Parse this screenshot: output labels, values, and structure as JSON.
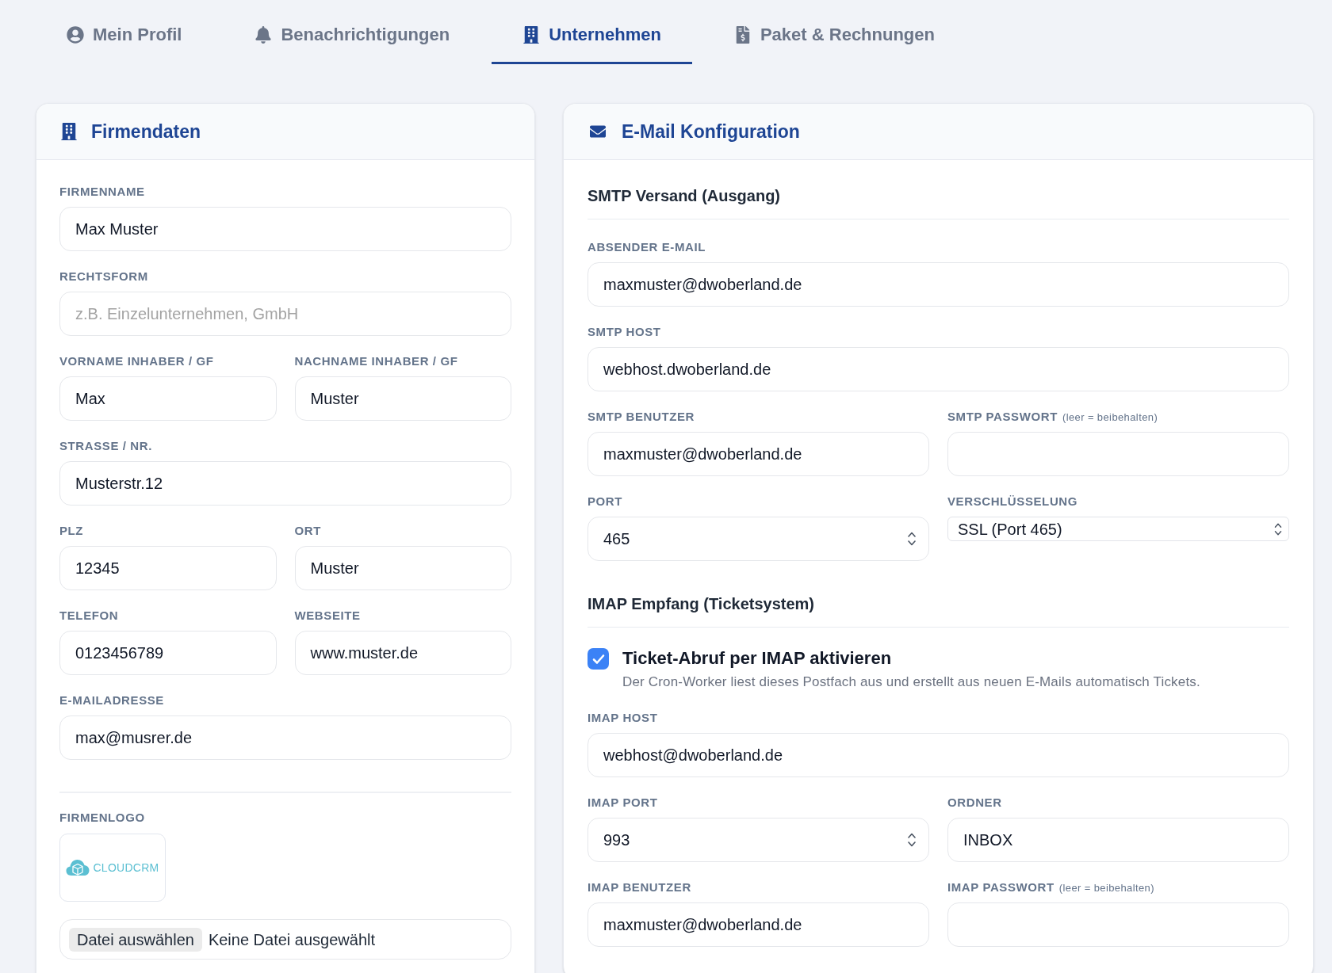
{
  "tabs": [
    {
      "label": "Mein Profil",
      "selected": false
    },
    {
      "label": "Benachrichtigungen",
      "selected": false
    },
    {
      "label": "Unternehmen",
      "selected": true
    },
    {
      "label": "Paket & Rechnungen",
      "selected": false
    }
  ],
  "company_card": {
    "title": "Firmendaten",
    "rows": [
      [
        {
          "label": "FIRMENNAME",
          "kind": "text",
          "value": "Max Muster"
        }
      ],
      [
        {
          "label": "RECHTSFORM",
          "kind": "text",
          "placeholder": "z.B. Einzelunternehmen, GmbH"
        }
      ],
      [
        {
          "label": "VORNAME INHABER / GF",
          "kind": "text",
          "value": "Max"
        },
        {
          "label": "NACHNAME INHABER / GF",
          "kind": "text",
          "value": "Muster"
        }
      ],
      [
        {
          "label": "STRASSE / NR.",
          "kind": "text",
          "value": "Musterstr.12"
        }
      ],
      [
        {
          "label": "PLZ",
          "kind": "text",
          "value": "12345"
        },
        {
          "label": "ORT",
          "kind": "text",
          "value": "Muster"
        }
      ],
      [
        {
          "label": "TELEFON",
          "kind": "text",
          "value": "0123456789"
        },
        {
          "label": "WEBSEITE",
          "kind": "text",
          "value": "www.muster.de"
        }
      ],
      [
        {
          "label": "E-MAILADRESSE",
          "kind": "text",
          "value": "max@musrer.de"
        }
      ]
    ],
    "logo": {
      "label": "FIRMENLOGO",
      "wordmark": "CLOUDCRM"
    },
    "file_input": {
      "button": "Datei auswählen",
      "status": "Keine Datei ausgewählt"
    }
  },
  "email_card": {
    "title": "E-Mail Konfiguration",
    "sections": [
      {
        "heading": "SMTP Versand (Ausgang)",
        "rows": [
          [
            {
              "label": "ABSENDER E-MAIL",
              "kind": "text",
              "value": "maxmuster@dwoberland.de"
            }
          ],
          [
            {
              "label": "SMTP HOST",
              "kind": "text",
              "value": "webhost.dwoberland.de"
            }
          ],
          [
            {
              "label": "SMTP BENUTZER",
              "kind": "text",
              "value": "maxmuster@dwoberland.de"
            },
            {
              "label": "SMTP PASSWORT",
              "hint": "(leer = beibehalten)",
              "kind": "password"
            }
          ],
          [
            {
              "label": "PORT",
              "kind": "number",
              "value": "465"
            },
            {
              "label": "VERSCHLÜSSELUNG",
              "kind": "select",
              "value": "SSL (Port 465)"
            }
          ]
        ]
      },
      {
        "heading": "IMAP Empfang (Ticketsystem)",
        "toggle": {
          "label": "Ticket-Abruf per IMAP aktivieren",
          "description": "Der Cron-Worker liest dieses Postfach aus und erstellt aus neuen E-Mails automatisch Tickets.",
          "checked": true
        },
        "rows": [
          [
            {
              "label": "IMAP HOST",
              "kind": "text",
              "value": "webhost@dwoberland.de"
            }
          ],
          [
            {
              "label": "IMAP PORT",
              "kind": "number",
              "value": "993"
            },
            {
              "label": "ORDNER",
              "kind": "text",
              "value": "INBOX"
            }
          ],
          [
            {
              "label": "IMAP BENUTZER",
              "kind": "text",
              "value": "maxmuster@dwoberland.de"
            },
            {
              "label": "IMAP PASSWORT",
              "hint": "(leer = beibehalten)",
              "kind": "password"
            }
          ]
        ]
      }
    ]
  }
}
